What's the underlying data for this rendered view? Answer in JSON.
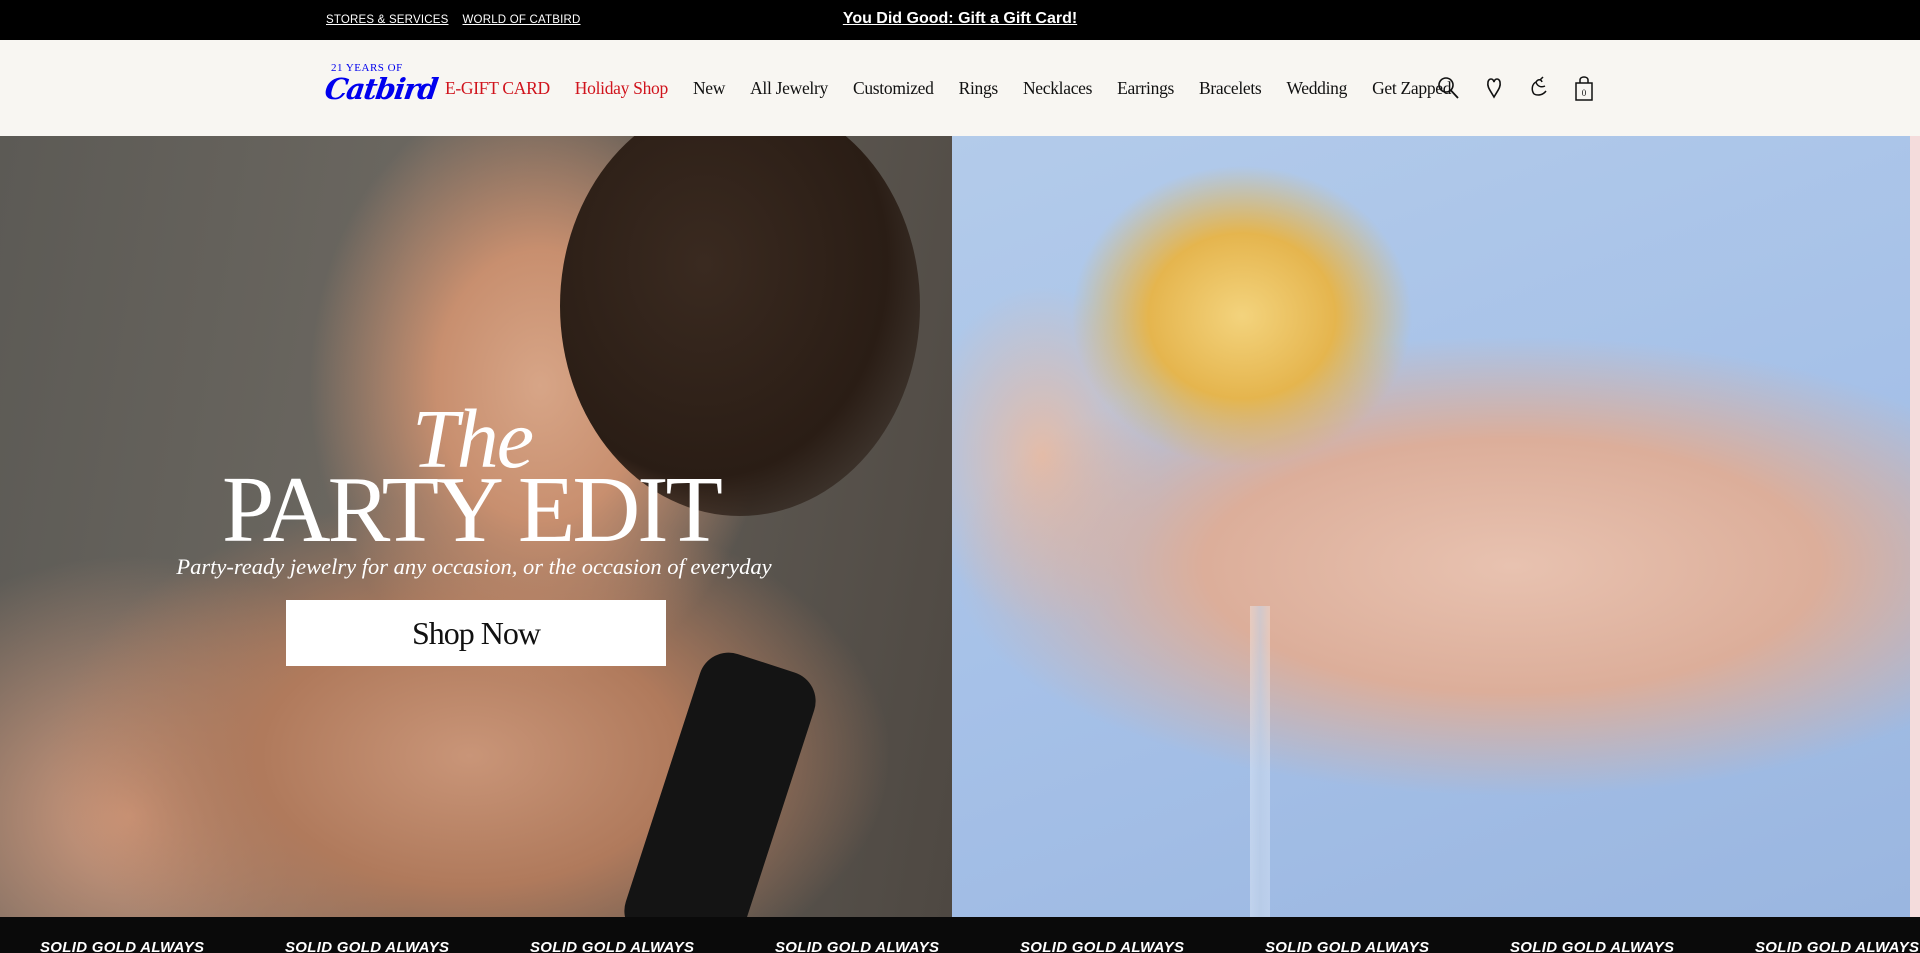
{
  "topbar": {
    "links": [
      "STORES & SERVICES",
      "WORLD OF CATBIRD"
    ],
    "promo": "You Did Good: Gift a Gift Card!"
  },
  "header": {
    "logo_years": "21 YEARS OF",
    "logo_name": "Catbird",
    "nav": [
      {
        "label": "E-GIFT CARD",
        "highlight": true
      },
      {
        "label": "Holiday Shop",
        "highlight": true
      },
      {
        "label": "New",
        "highlight": false
      },
      {
        "label": "All Jewelry",
        "highlight": false
      },
      {
        "label": "Customized",
        "highlight": false
      },
      {
        "label": "Rings",
        "highlight": false
      },
      {
        "label": "Necklaces",
        "highlight": false
      },
      {
        "label": "Earrings",
        "highlight": false
      },
      {
        "label": "Bracelets",
        "highlight": false
      },
      {
        "label": "Wedding",
        "highlight": false
      },
      {
        "label": "Get Zapped",
        "highlight": false
      }
    ],
    "icons": [
      "search-icon",
      "heart-icon",
      "catbird-account-icon",
      "shopping-bag-icon"
    ],
    "cart_count": "0"
  },
  "hero": {
    "title_small": "The",
    "title_large": "PARTY EDIT",
    "subtitle": "Party-ready jewelry for any occasion, or the occasion of everyday",
    "cta": "Shop Now"
  },
  "ticker": {
    "text": "SOLID GOLD ALWAYS",
    "repeat": 8
  },
  "colors": {
    "accent_red": "#d0131c",
    "topbar_bg": "#000000",
    "header_bg": "#f8f6f2"
  }
}
